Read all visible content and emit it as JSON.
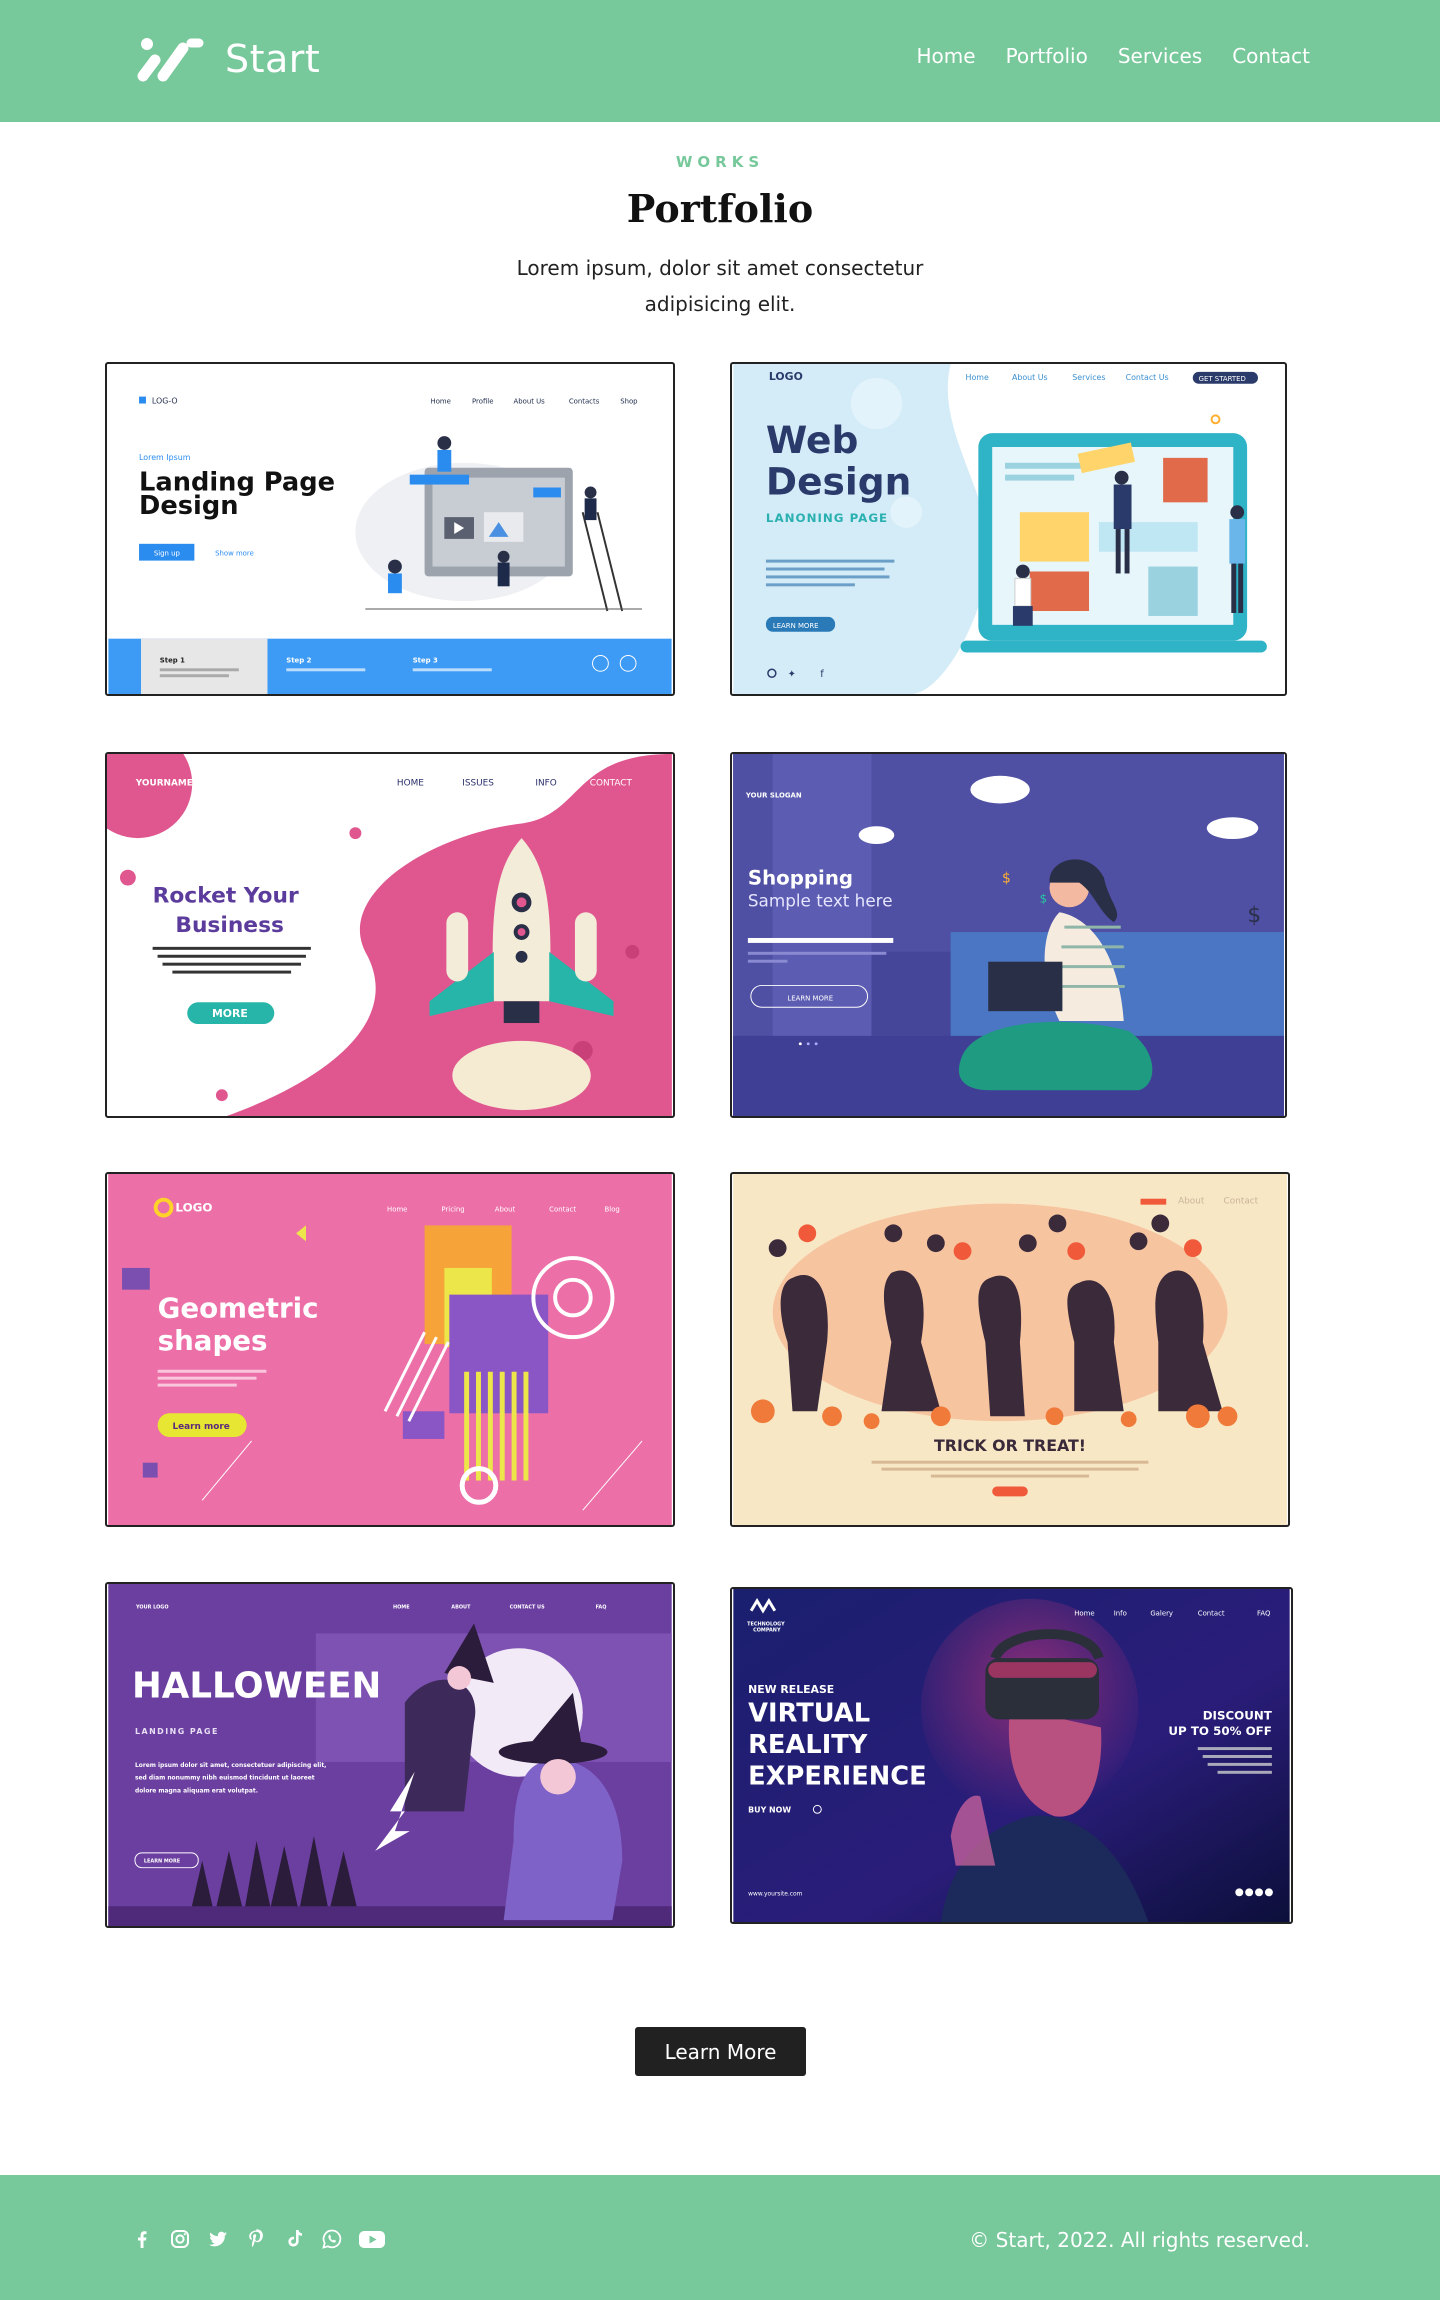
{
  "header": {
    "brand_name": "Start",
    "nav": [
      "Home",
      "Portfolio",
      "Services",
      "Contact"
    ]
  },
  "section": {
    "kicker": "WORKS",
    "title": "Portfolio",
    "description": "Lorem ipsum, dolor sit amet consectetur adipisicing elit."
  },
  "cards": {
    "landing": {
      "logo": "LOG-O",
      "nav": [
        "Home",
        "Profile",
        "About Us",
        "Contacts",
        "Shop"
      ],
      "kicker": "Lorem Ipsum",
      "title_line1": "Landing Page",
      "title_line2": "Design",
      "signup": "Sign up",
      "show_more": "Show more",
      "step1": "Step 1",
      "step2": "Step 2",
      "step3": "Step 3"
    },
    "webdesign": {
      "logo": "LOGO",
      "nav": [
        "Home",
        "About Us",
        "Services",
        "Contact Us"
      ],
      "cta": "GET STARTED",
      "title_line1": "Web",
      "title_line2": "Design",
      "subtitle": "LANONING PAGE",
      "button": "LEARN MORE"
    },
    "rocket": {
      "brand": "YOURNAME",
      "nav": [
        "HOME",
        "ISSUES",
        "INFO",
        "CONTACT"
      ],
      "title_line1": "Rocket Your",
      "title_line2": "Business",
      "button": "MORE"
    },
    "shopping": {
      "slogan": "YOUR SLOGAN",
      "title": "Shopping",
      "subtitle": "Sample text here",
      "button": "LEARN MORE"
    },
    "geometric": {
      "logo": "LOGO",
      "nav": [
        "Home",
        "Pricing",
        "About",
        "Contact",
        "Blog"
      ],
      "title_line1": "Geometric",
      "title_line2": "shapes",
      "button": "Learn more"
    },
    "halloween_party": {
      "nav": [
        "About",
        "Contact"
      ],
      "title": "TRICK OR TREAT!"
    },
    "halloween": {
      "logo": "YOUR LOGO",
      "nav": [
        "HOME",
        "ABOUT",
        "CONTACT US",
        "FAQ"
      ],
      "title": "HALLOWEEN",
      "subtitle": "LANDING PAGE",
      "body1": "Lorem ipsum dolor sit amet, consectetuer adipiscing elit,",
      "body2": "sed diam nonummy nibh euismod tincidunt ut laoreet",
      "body3": "dolore magna aliquam erat volutpat.",
      "button": "LEARN MORE"
    },
    "vr": {
      "company_line1": "TECHNOLOGY",
      "company_line2": "COMPANY",
      "nav": [
        "Home",
        "Info",
        "Galery",
        "Contact",
        "FAQ"
      ],
      "kicker": "NEW RELEASE",
      "title_line1": "VIRTUAL",
      "title_line2": "REALITY",
      "title_line3": "EXPERIENCE",
      "buy": "BUY NOW",
      "discount_line1": "DISCOUNT",
      "discount_line2": "UP TO 50% OFF",
      "site": "www.yoursite.com"
    }
  },
  "learn_more": "Learn More",
  "footer": {
    "social": [
      "facebook",
      "instagram",
      "twitter",
      "pinterest",
      "tiktok",
      "whatsapp",
      "youtube"
    ],
    "copyright": "© Start, 2022. All rights reserved."
  },
  "colors": {
    "brand_green": "#77c89a",
    "button_dark": "#212121"
  }
}
